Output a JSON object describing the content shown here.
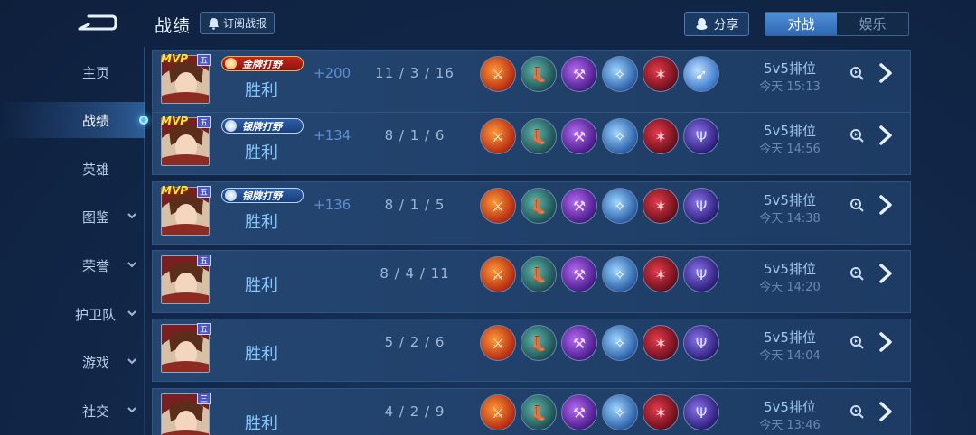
{
  "header": {
    "title": "战绩",
    "subscribe_label": "订阅战报",
    "share_label": "分享",
    "tabs": [
      {
        "label": "对战",
        "active": true
      },
      {
        "label": "娱乐",
        "active": false
      }
    ]
  },
  "sidebar": {
    "items": [
      {
        "label": "主页",
        "active": false,
        "expandable": false
      },
      {
        "label": "战绩",
        "active": true,
        "expandable": false
      },
      {
        "label": "英雄",
        "active": false,
        "expandable": false
      },
      {
        "label": "图鉴",
        "active": false,
        "expandable": true
      },
      {
        "label": "荣誉",
        "active": false,
        "expandable": true
      },
      {
        "label": "护卫队",
        "active": false,
        "expandable": true
      },
      {
        "label": "游戏",
        "active": false,
        "expandable": true
      },
      {
        "label": "社交",
        "active": false,
        "expandable": true
      }
    ]
  },
  "matches": [
    {
      "mvp": "MVP",
      "rank": "五",
      "badge": "金牌打野",
      "badge_type": "gold",
      "result": "胜利",
      "points": "+200",
      "kda": "11 / 3 / 16",
      "mode": "5v5排位",
      "time": "今天 15:13",
      "items": [
        "sword",
        "boots",
        "axe",
        "blade",
        "spike",
        "spear"
      ]
    },
    {
      "mvp": "MVP",
      "rank": "五",
      "badge": "银牌打野",
      "badge_type": "silver",
      "result": "胜利",
      "points": "+134",
      "kda": "8 / 1 / 6",
      "mode": "5v5排位",
      "time": "今天 14:56",
      "items": [
        "sword",
        "boots",
        "axe",
        "blade",
        "spike",
        "trident"
      ]
    },
    {
      "mvp": "MVP",
      "rank": "五",
      "badge": "银牌打野",
      "badge_type": "silver",
      "result": "胜利",
      "points": "+136",
      "kda": "8 / 1 / 5",
      "mode": "5v5排位",
      "time": "今天 14:38",
      "items": [
        "sword",
        "boots",
        "axe",
        "blade",
        "spike",
        "trident"
      ]
    },
    {
      "mvp": "",
      "rank": "五",
      "badge": "",
      "badge_type": "",
      "result": "胜利",
      "points": "",
      "kda": "8 / 4 / 11",
      "mode": "5v5排位",
      "time": "今天 14:20",
      "items": [
        "sword",
        "boots",
        "axe",
        "blade",
        "spike",
        "trident"
      ]
    },
    {
      "mvp": "",
      "rank": "五",
      "badge": "",
      "badge_type": "",
      "result": "胜利",
      "points": "",
      "kda": "5 / 2 / 6",
      "mode": "5v5排位",
      "time": "今天 14:04",
      "items": [
        "sword",
        "boots",
        "axe",
        "blade",
        "spike",
        "trident"
      ]
    },
    {
      "mvp": "",
      "rank": "三",
      "badge": "",
      "badge_type": "",
      "result": "胜利",
      "points": "",
      "kda": "4 / 2 / 9",
      "mode": "5v5排位",
      "time": "今天 13:46",
      "items": [
        "sword",
        "boots",
        "axe",
        "blade",
        "spike",
        "trident"
      ]
    }
  ],
  "colors": {
    "background": "#132a4d",
    "row": "#20406a",
    "accent": "#4fc3ff",
    "win_text": "#86c6ff"
  }
}
